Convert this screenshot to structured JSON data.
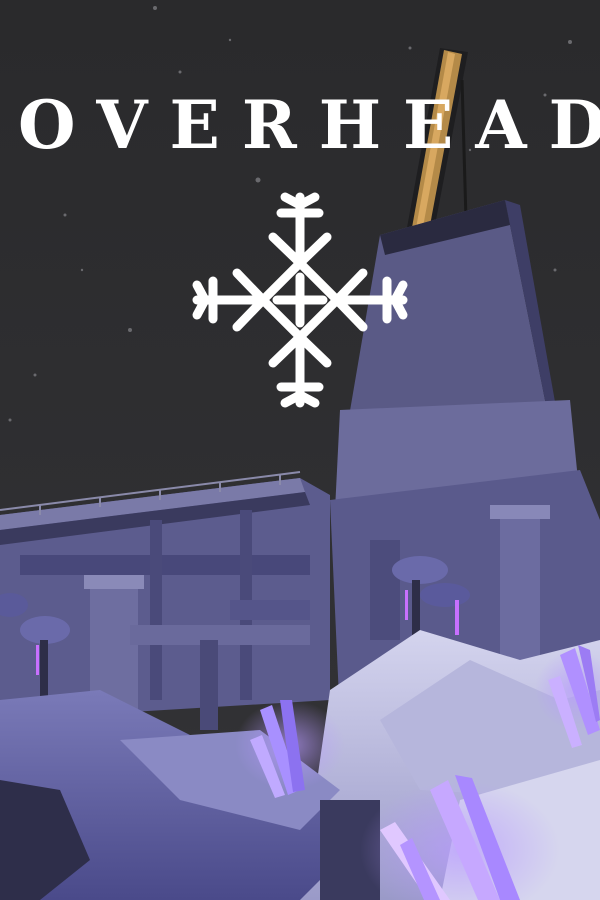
{
  "game": {
    "title": "OVERHEAD"
  },
  "colors": {
    "sky": "#2b2b2d",
    "structure": "#6a6a98",
    "snow": "#c8c8e4",
    "crystal": "#9a7cff",
    "crane": "#b48a48",
    "title": "#ffffff"
  },
  "icons": {
    "emblem": "snowflake-rune-icon"
  }
}
